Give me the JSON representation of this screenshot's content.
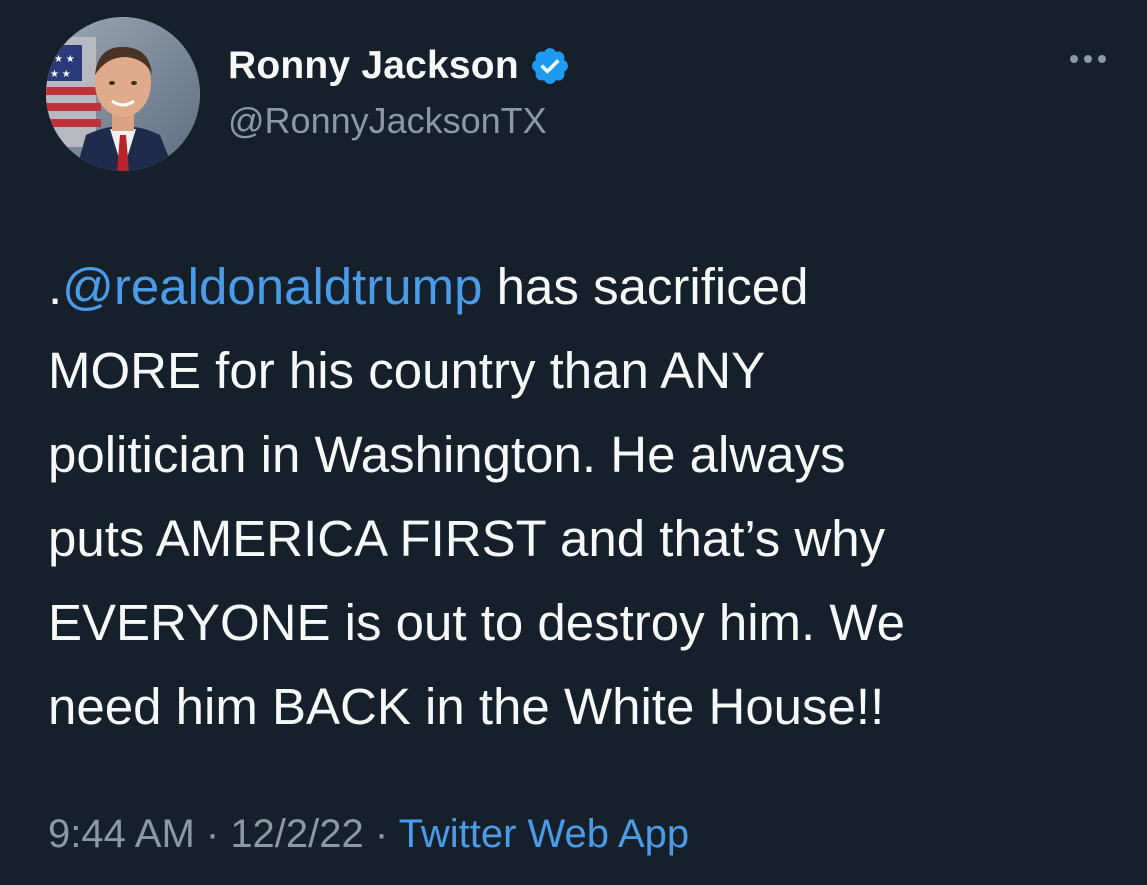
{
  "author": {
    "display_name": "Ronny Jackson",
    "handle": "@RonnyJacksonTX",
    "verified": true
  },
  "tweet": {
    "prefix": ".",
    "mention": "@realdonaldtrump",
    "body": " has sacrificed\nMORE for his country than ANY\npolitician in Washington. He always\nputs AMERICA FIRST and that’s why\nEVERYONE is out to destroy him. We\nneed him BACK in the White House!!"
  },
  "meta": {
    "time": "9:44 AM",
    "sep1": " · ",
    "date": "12/2/22",
    "sep2": " · ",
    "source": "Twitter Web App"
  },
  "icons": {
    "verified": "verified-badge-icon",
    "more": "more-options-icon"
  },
  "colors": {
    "background": "#15202b",
    "text": "#f7f9f9",
    "secondary": "#8b98a5",
    "link": "#4a9be8",
    "verified": "#1d9bf0"
  }
}
